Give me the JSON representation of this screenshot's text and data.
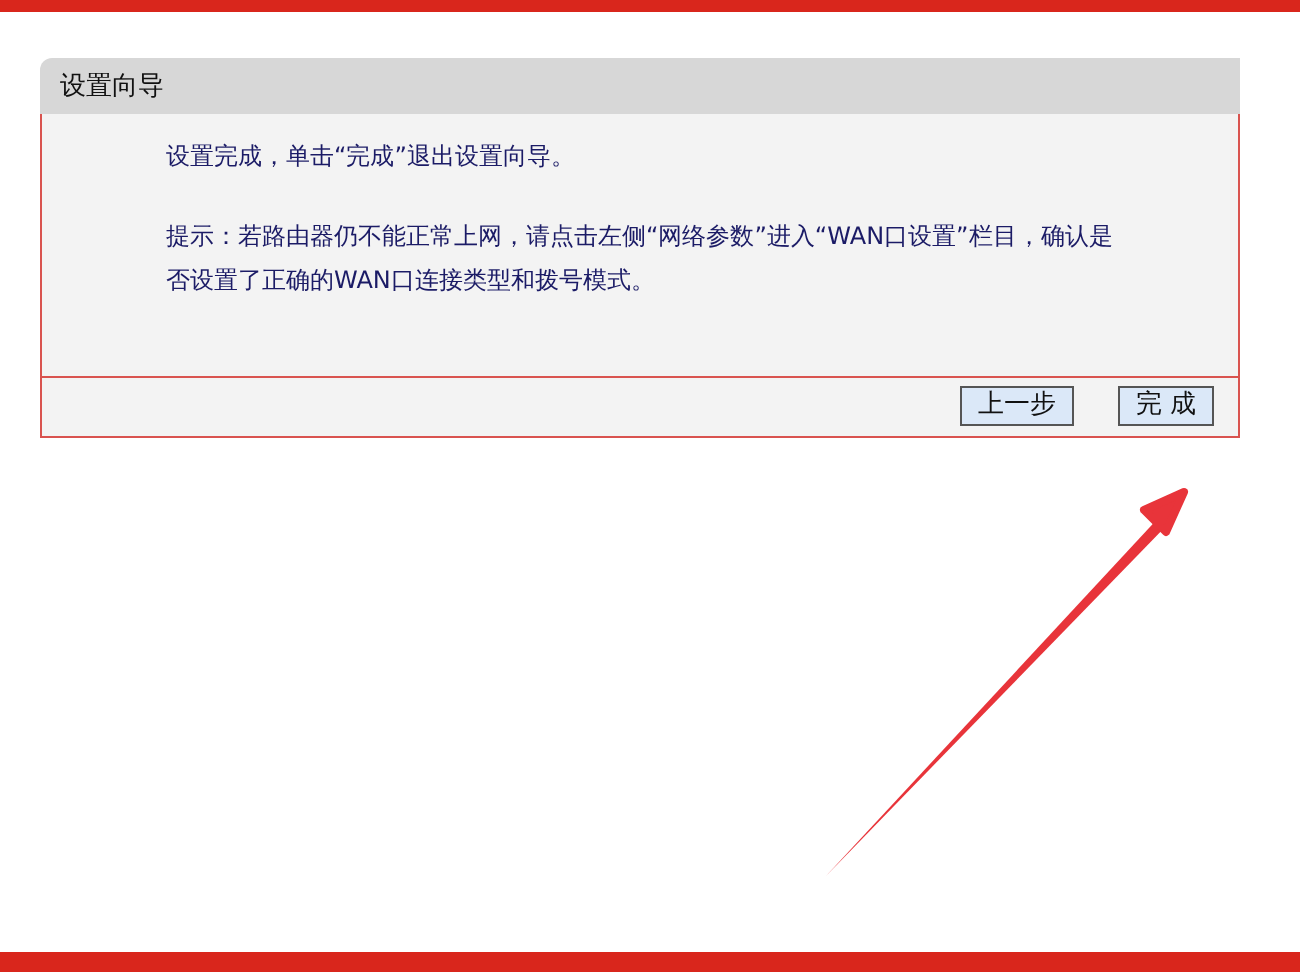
{
  "wizard": {
    "title": "设置向导",
    "messages": [
      "设置完成，单击“完成”退出设置向导。",
      "提示：若路由器仍不能正常上网，请点击左侧“网络参数”进入“WAN口设置”栏目，确认是否设置了正确的WAN口连接类型和拨号模式。"
    ],
    "buttons": [
      "上一步",
      "完 成"
    ]
  }
}
